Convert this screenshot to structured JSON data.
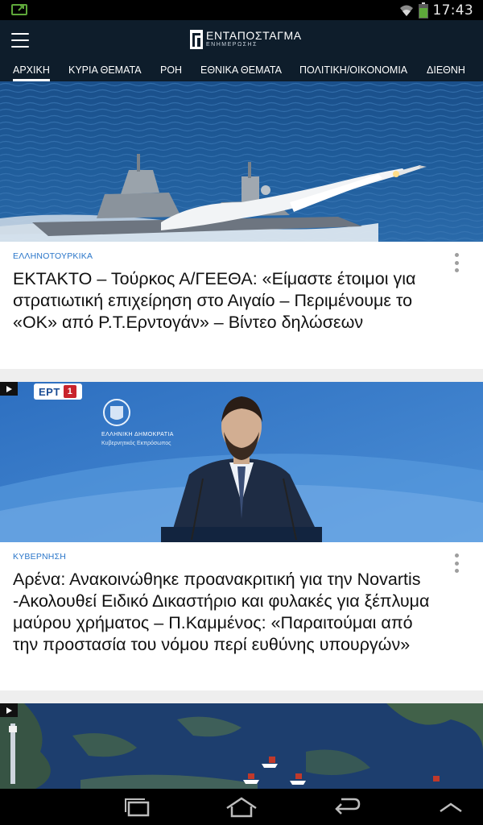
{
  "status_bar": {
    "time": "17:43",
    "icons": [
      "screen-cast-icon",
      "wifi-icon",
      "battery-icon"
    ]
  },
  "app_bar": {
    "menu_icon": "hamburger-menu-icon",
    "logo_title": "ΕΝΤΑΠΟΣΤΑΓΜΑ",
    "logo_subtitle": "ΕΝΗΜΕΡΩΣΗΣ"
  },
  "tabs": [
    {
      "label": "ΑΡΧΙΚΗ",
      "active": true
    },
    {
      "label": "ΚΥΡΙΑ ΘΕΜΑΤΑ",
      "active": false
    },
    {
      "label": "ΡΟΗ",
      "active": false
    },
    {
      "label": "ΕΘΝΙΚΑ ΘΕΜΑΤΑ",
      "active": false
    },
    {
      "label": "ΠΟΛΙΤΙΚΗ/ΟΙΚΟΝΟΜΙΑ",
      "active": false
    },
    {
      "label": "ΔΙΕΘΝΗ",
      "active": false
    }
  ],
  "articles": [
    {
      "category": "ΕΛΛΗΝΟΤΟΥΡΚΙΚΑ",
      "title": "ΕΚΤΑΚΤΟ – Τούρκος Α/ΓΕΕΘΑ: «Είμαστε έτοιμοι για στρατιωτική επιχείρηση στο Αιγαίο – Περιμένουμε το «ΟΚ» από Ρ.Τ.Ερντογάν» – Βίντεο δηλώσεων",
      "image": "missile-launch-from-warship",
      "has_video": false
    },
    {
      "category": "ΚΥΒΕΡΝΗΣΗ",
      "title": "Αρένα: Ανακοινώθηκε προανακριτική για την Novartis -Ακολουθεί Ειδικό Δικαστήριο και φυλακές για ξέπλυμα μαύρου χρήματος – Π.Καμμένος: «Παραιτούμαι από την προστασία του νόμου περί ευθύνης υπουργών»",
      "image": "government-spokesman-press-briefing",
      "has_video": true,
      "ert_label": "ΕΡΤ",
      "ert_number": "1",
      "gov_line1": "ΕΛΛΗΝΙΚΗ ΔΗΜΟΚΡΑΤΙΑ",
      "gov_line2": "Κυβερνητικός Εκπρόσωπος"
    },
    {
      "category": "",
      "title": "",
      "image": "aegean-sea-map-with-ships",
      "has_video": true
    }
  ],
  "nav_bar": {
    "buttons": [
      "recent-apps-icon",
      "home-icon",
      "back-icon",
      "chevron-up-icon"
    ]
  },
  "colors": {
    "app_bar": "#0e1d2b",
    "category": "#2a76c9",
    "title": "#111111"
  }
}
